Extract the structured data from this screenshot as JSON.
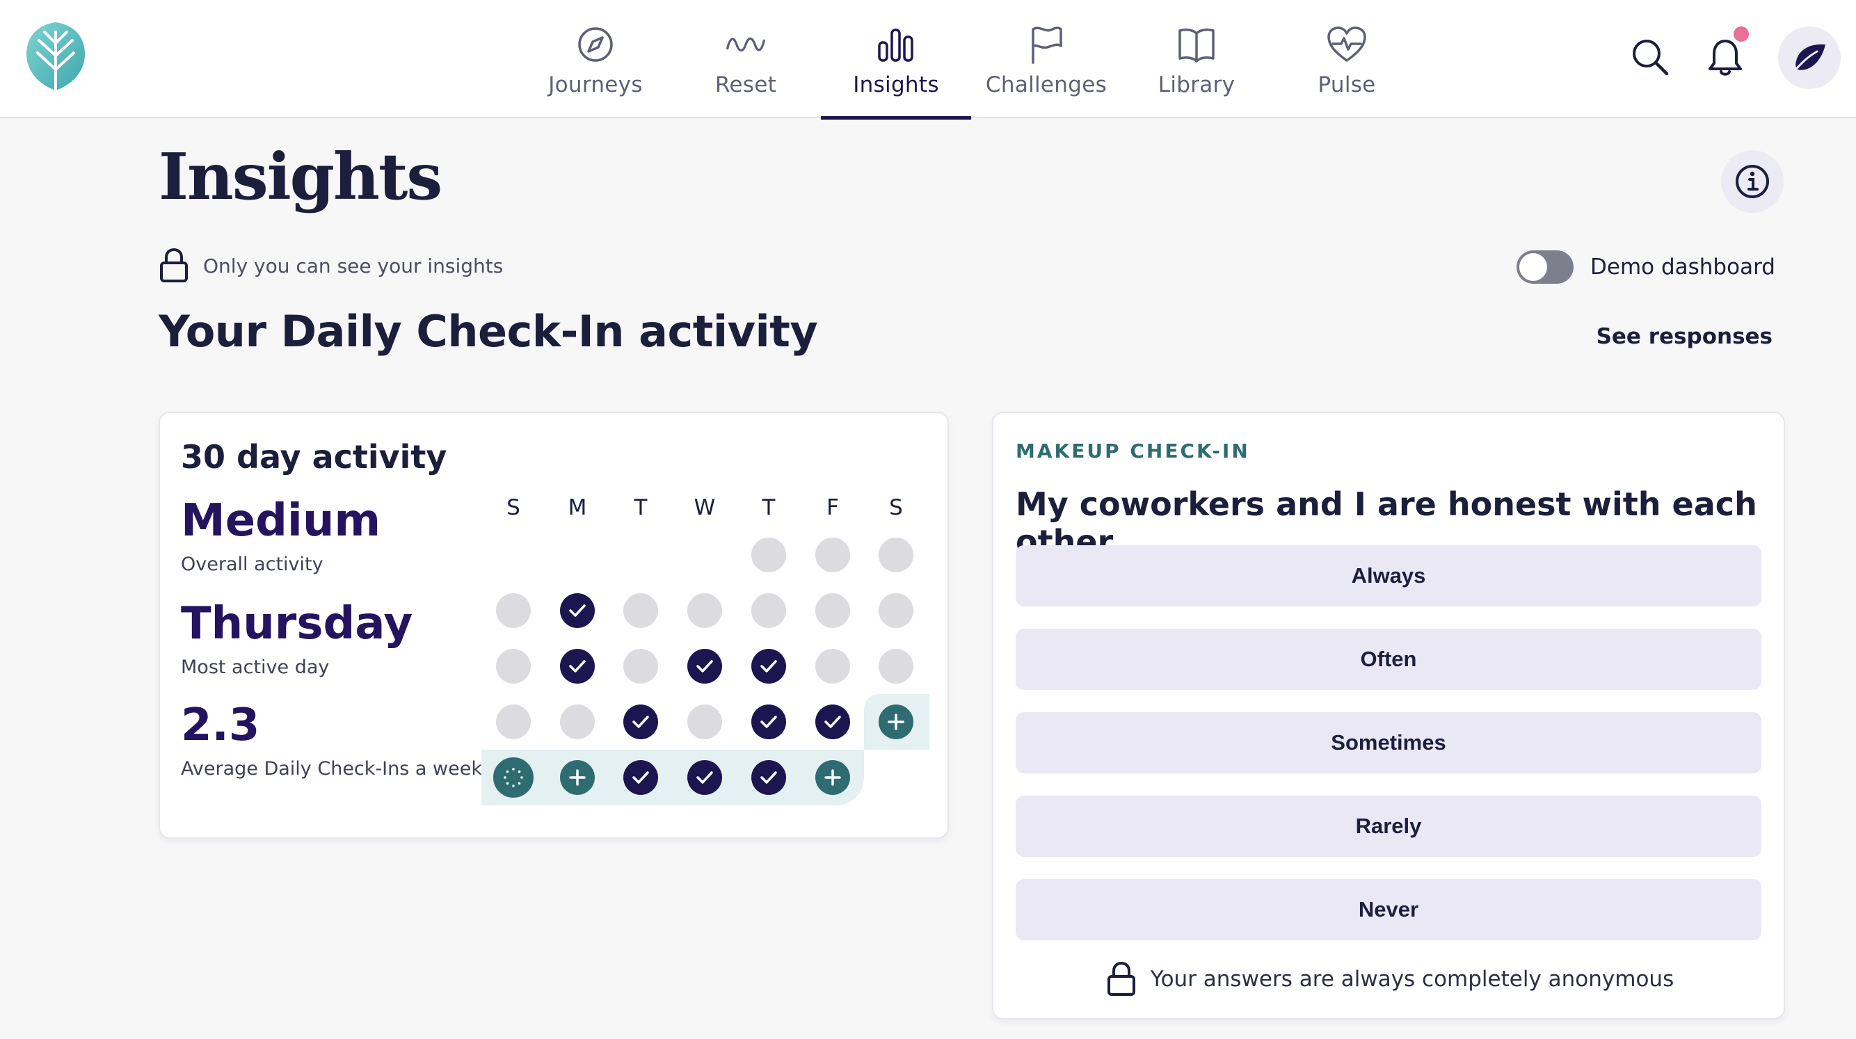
{
  "nav": {
    "items": [
      {
        "label": "Journeys",
        "icon": "compass-icon"
      },
      {
        "label": "Reset",
        "icon": "wave-icon"
      },
      {
        "label": "Insights",
        "icon": "bar-chart-icon",
        "active": true
      },
      {
        "label": "Challenges",
        "icon": "flag-icon"
      },
      {
        "label": "Library",
        "icon": "book-icon"
      },
      {
        "label": "Pulse",
        "icon": "heart-pulse-icon"
      }
    ]
  },
  "page": {
    "title": "Insights",
    "privacy_note": "Only you can see your insights",
    "demo_label": "Demo dashboard",
    "demo_enabled": false,
    "section_title": "Your Daily Check-In activity",
    "see_responses": "See responses"
  },
  "activity": {
    "title": "30 day activity",
    "stats": [
      {
        "value": "Medium",
        "label": "Overall activity"
      },
      {
        "value": "Thursday",
        "label": "Most active day"
      },
      {
        "value": "2.3",
        "label": "Average Daily Check-Ins a week"
      }
    ],
    "day_headers": [
      "S",
      "M",
      "T",
      "W",
      "T",
      "F",
      "S"
    ],
    "weeks": [
      [
        null,
        null,
        null,
        null,
        "empty",
        "empty",
        "empty"
      ],
      [
        "empty",
        "done",
        "empty",
        "empty",
        "empty",
        "empty",
        "empty"
      ],
      [
        "empty",
        "done",
        "empty",
        "done",
        "done",
        "empty",
        "empty"
      ],
      [
        "empty",
        "empty",
        "done",
        "empty",
        "done",
        "done",
        "add"
      ],
      [
        "today",
        "add",
        "done",
        "done",
        "done",
        "add",
        null
      ]
    ]
  },
  "checkin": {
    "eyebrow": "MAKEUP CHECK-IN",
    "question": "My coworkers and I are honest with each other.",
    "answers": [
      "Always",
      "Often",
      "Sometimes",
      "Rarely",
      "Never"
    ],
    "anonymous_note": "Your answers are always completely anonymous"
  },
  "colors": {
    "brand_navy": "#1d1550",
    "teal": "#2f6c72",
    "notification": "#ea6f96",
    "answer_bg": "#ebe8f5"
  }
}
